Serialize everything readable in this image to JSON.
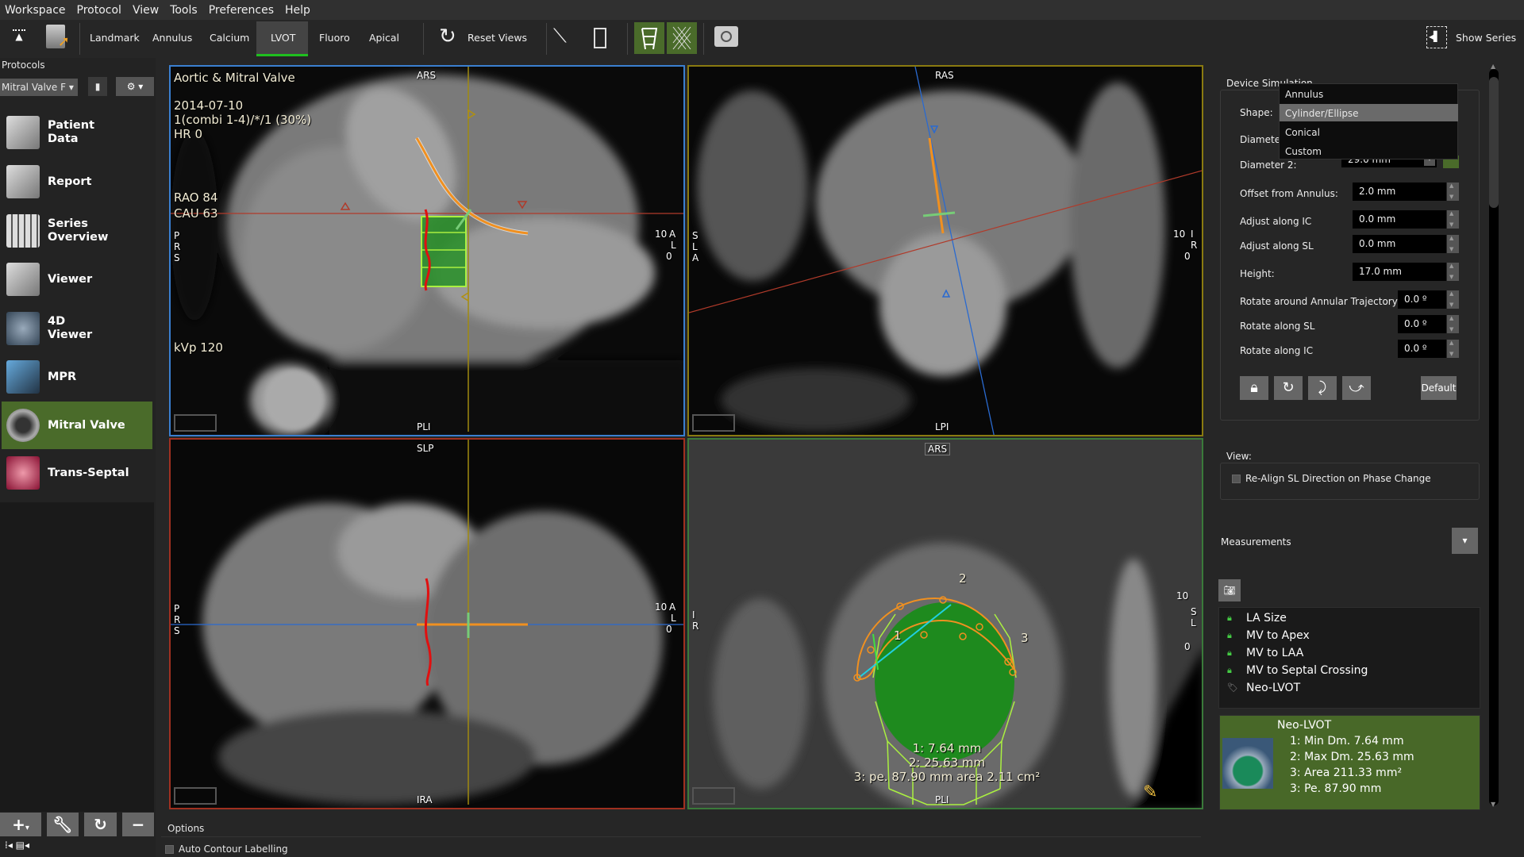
{
  "menu": [
    "Workspace",
    "Protocol",
    "View",
    "Tools",
    "Preferences",
    "Help"
  ],
  "toolbar": {
    "tabs": [
      "Landmark",
      "Annulus",
      "Calcium",
      "LVOT",
      "Fluoro",
      "Apical"
    ],
    "active_tab": "LVOT",
    "reset_views": "Reset Views",
    "show_series": "Show Series"
  },
  "sidebar": {
    "title": "Protocols",
    "protocol_select": "Mitral Valve F",
    "items": [
      {
        "label": "Patient\nData"
      },
      {
        "label": "Report"
      },
      {
        "label": "Series\nOverview"
      },
      {
        "label": "Viewer"
      },
      {
        "label": "4D\nViewer"
      },
      {
        "label": "MPR"
      },
      {
        "label": "Mitral Valve"
      },
      {
        "label": "Trans-Septal"
      }
    ],
    "active": "Mitral Valve"
  },
  "viewports": {
    "tl": {
      "title": "Aortic & Mitral Valve",
      "date": "2014-07-10",
      "series": "1(combi 1-4)/*/1 (30%)",
      "hr": "HR 0",
      "rao": "RAO 84",
      "cau": "CAU 63",
      "kvp": "kVp 120",
      "top": "ARS",
      "bottom": "PLI",
      "left": [
        "P",
        "R",
        "S"
      ],
      "scale_top": "10",
      "scale_letters": [
        "A",
        "L"
      ],
      "scale_bottom": "0"
    },
    "tr": {
      "top": "RAS",
      "bottom": "LPI",
      "left": [
        "S",
        "L",
        "A"
      ],
      "scale_top": "10",
      "scale_letters": [
        "I",
        "R"
      ],
      "scale_bottom": "0"
    },
    "bl": {
      "top": "SLP",
      "bottom": "IRA",
      "left": [
        "P",
        "R",
        "S"
      ],
      "scale_top": "10",
      "scale_letters": [
        "A",
        "L"
      ],
      "scale_bottom": "0"
    },
    "br": {
      "top": "ARS",
      "bottom": "PLI",
      "left": [
        "I",
        "R"
      ],
      "scale_top": "10",
      "scale_letters": [
        "S",
        "L"
      ],
      "scale_bottom": "0",
      "points": [
        "1",
        "2",
        "3"
      ],
      "m1": "1: 7.64 mm",
      "m2": "2: 25.63 mm",
      "m3": "3: pe. 87.90 mm area 2.11 cm²"
    }
  },
  "device_sim": {
    "title": "Device Simulation",
    "shape_label": "Shape:",
    "shape_options": [
      "Annulus",
      "Cylinder/Ellipse",
      "Conical",
      "Custom"
    ],
    "shape_selected": "Cylinder/Ellipse",
    "diameter1_label": "Diamete",
    "diameter2_label": "Diameter 2:",
    "diameter2_value": "29.0 mm",
    "fields": [
      {
        "label": "Offset from Annulus:",
        "value": "2.0 mm"
      },
      {
        "label": "Adjust along IC",
        "value": "0.0 mm"
      },
      {
        "label": "Adjust along SL",
        "value": "0.0 mm"
      },
      {
        "label": "Height:",
        "value": "17.0 mm"
      },
      {
        "label": "Rotate around Annular Trajectory",
        "value": "0.0 º"
      },
      {
        "label": "Rotate along SL",
        "value": "0.0 º"
      },
      {
        "label": "Rotate along IC",
        "value": "0.0 º"
      }
    ],
    "default_label": "Default"
  },
  "view": {
    "title": "View:",
    "realign": "Re-Align SL Direction on Phase Change"
  },
  "measurements": {
    "title": "Measurements",
    "items": [
      "LA Size",
      "MV to Apex",
      "MV to LAA",
      "MV to Septal Crossing",
      "Neo-LVOT"
    ],
    "detail": {
      "title": "Neo-LVOT",
      "lines": [
        "1: Min Dm. 7.64 mm",
        "2: Max Dm. 25.63 mm",
        "3: Area 211.33 mm²",
        "3: Pe. 87.90 mm"
      ]
    }
  },
  "options": {
    "title": "Options",
    "auto_contour": "Auto Contour Labelling"
  },
  "colors": {
    "accent_green": "#4a6b2a",
    "tab_underline": "#1fbf1f",
    "vp_tl": "#3a7fd0",
    "vp_tr": "#8a7a10",
    "vp_bl": "#a03020",
    "vp_br": "#3a7a3a"
  }
}
